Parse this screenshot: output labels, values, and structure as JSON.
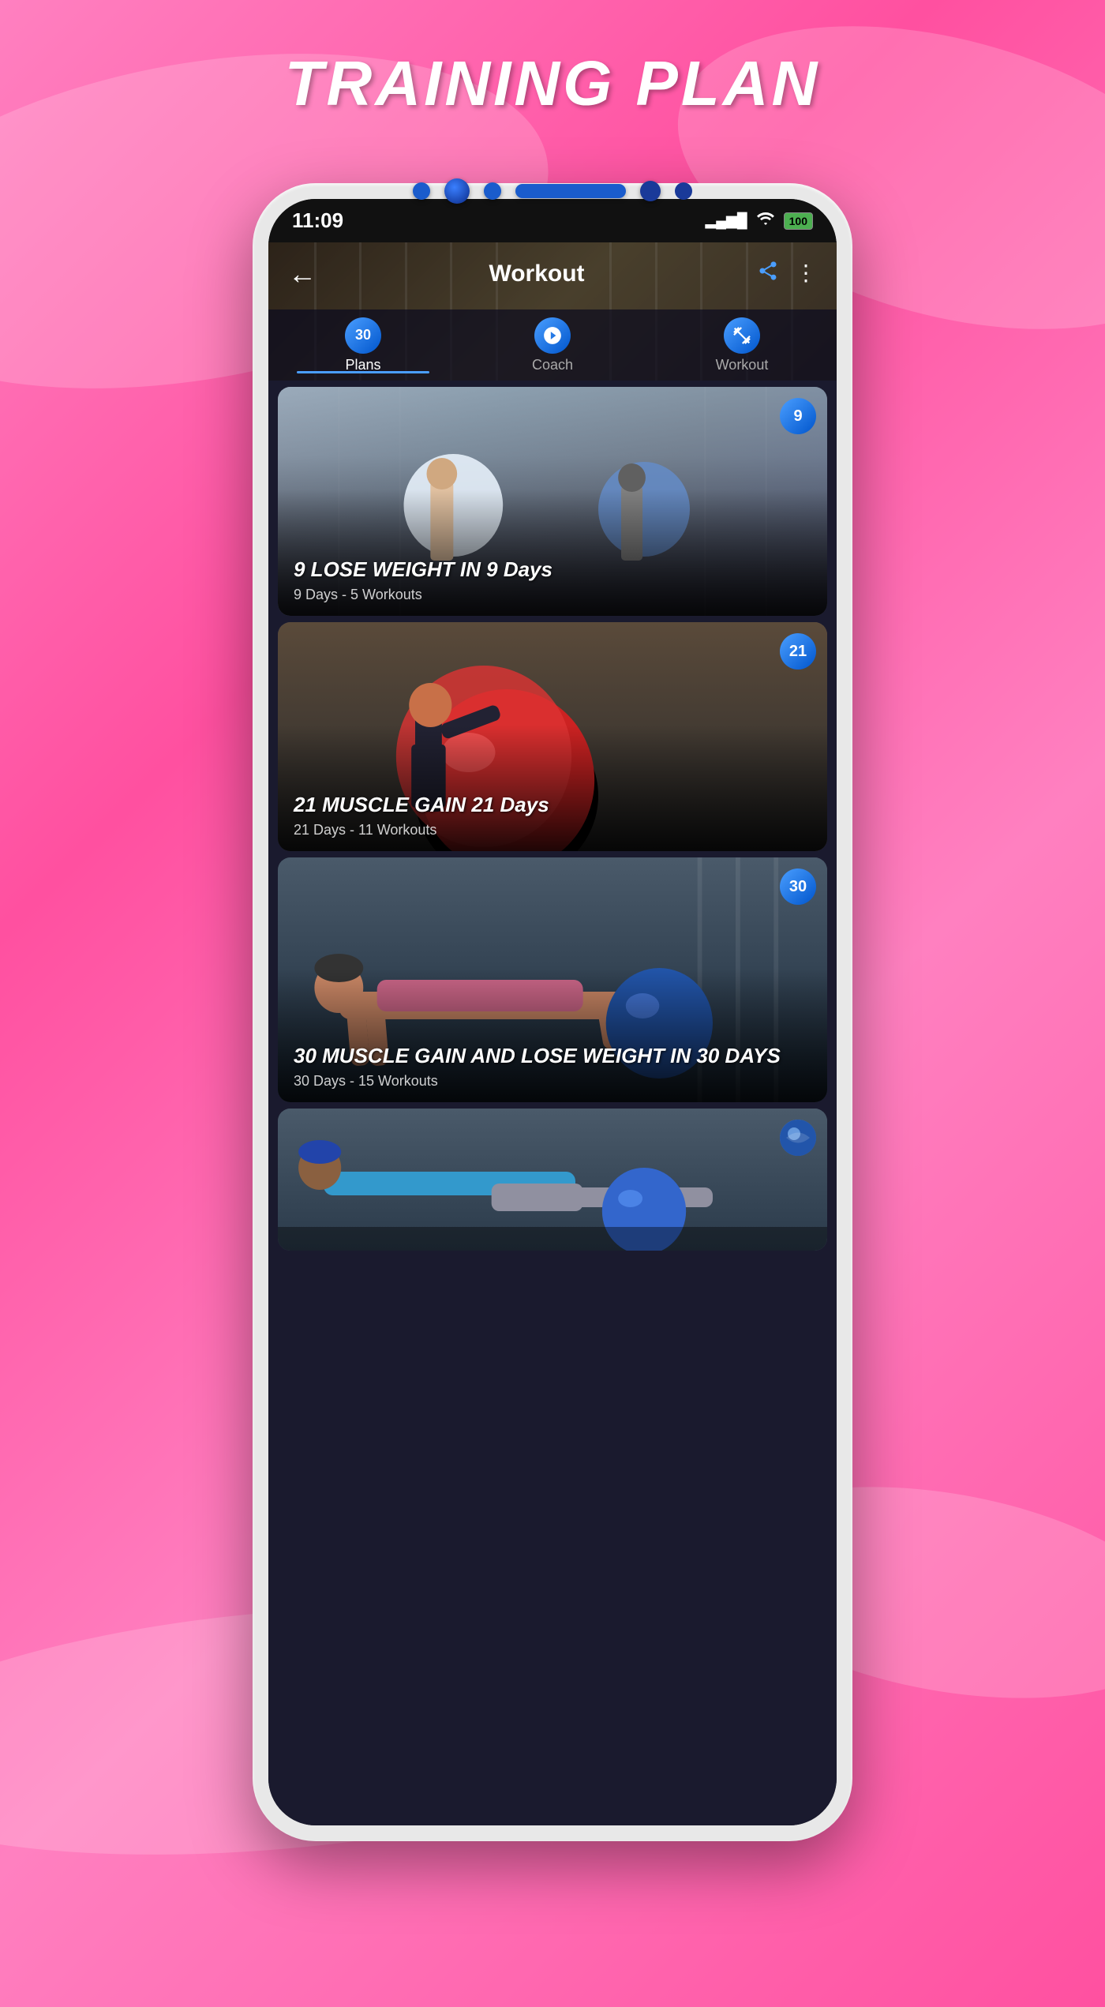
{
  "page": {
    "title": "TRAINING PLAN",
    "background_color": "#ff50a0"
  },
  "status_bar": {
    "time": "11:09",
    "battery": "100",
    "signal_bars": "▂▄▆█",
    "wifi": "wifi"
  },
  "header": {
    "title": "Workout",
    "back_label": "←",
    "share_label": "share",
    "menu_label": "⋮"
  },
  "tabs": [
    {
      "id": "plans",
      "label": "Plans",
      "badge": "30",
      "active": true
    },
    {
      "id": "coach",
      "label": "Coach",
      "icon": "sphere",
      "active": false
    },
    {
      "id": "workout",
      "label": "Workout",
      "icon": "snowflake",
      "active": false
    }
  ],
  "cards": [
    {
      "id": "card-1",
      "badge_number": "9",
      "title": "9 LOSE WEIGHT IN 9 Days",
      "subtitle": "9 Days - 5 Workouts",
      "theme": "gym-partners"
    },
    {
      "id": "card-2",
      "badge_number": "21",
      "title": "21 MUSCLE GAIN 21 Days",
      "subtitle": "21 Days - 11 Workouts",
      "theme": "exercise-ball"
    },
    {
      "id": "card-3",
      "badge_number": "30",
      "title": "30 MUSCLE GAIN AND LOSE WEIGHT IN 30 DAYS",
      "subtitle": "30 Days - 15 Workouts",
      "theme": "plank"
    },
    {
      "id": "card-4",
      "badge_number": "",
      "title": "",
      "subtitle": "",
      "theme": "partial"
    }
  ]
}
